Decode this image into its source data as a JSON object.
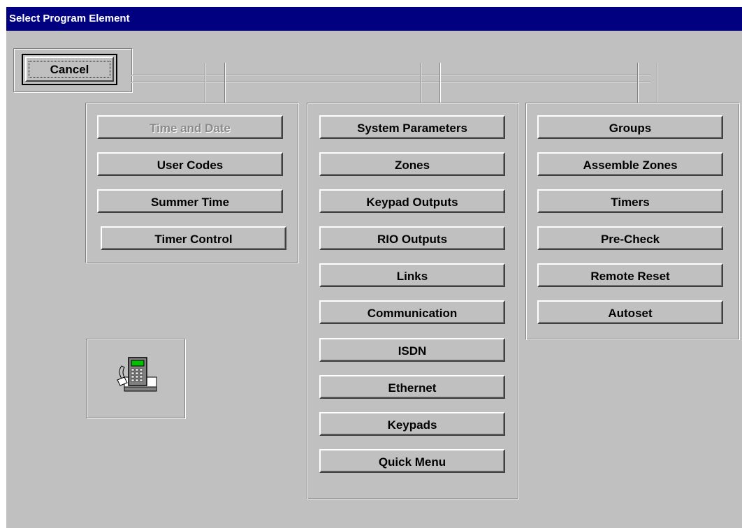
{
  "window": {
    "title": "Select Program Element"
  },
  "cancel_button": {
    "label": "Cancel"
  },
  "columns": {
    "left": [
      {
        "label": "Time and Date",
        "disabled": true
      },
      {
        "label": "User Codes",
        "disabled": false
      },
      {
        "label": "Summer Time",
        "disabled": false
      },
      {
        "label": "Timer Control",
        "disabled": false
      }
    ],
    "middle": [
      {
        "label": "System Parameters"
      },
      {
        "label": "Zones"
      },
      {
        "label": "Keypad Outputs"
      },
      {
        "label": "RIO Outputs"
      },
      {
        "label": "Links"
      },
      {
        "label": "Communication"
      },
      {
        "label": "ISDN"
      },
      {
        "label": "Ethernet"
      },
      {
        "label": "Keypads"
      },
      {
        "label": "Quick Menu"
      }
    ],
    "right": [
      {
        "label": "Groups"
      },
      {
        "label": "Assemble Zones"
      },
      {
        "label": "Timers"
      },
      {
        "label": "Pre-Check"
      },
      {
        "label": "Remote Reset"
      },
      {
        "label": "Autoset"
      }
    ]
  },
  "icon": {
    "name": "alarm-keypad-icon"
  },
  "colors": {
    "titlebar": "#000080",
    "face": "#c0c0c0",
    "disabled_text": "#8a8a8a"
  }
}
